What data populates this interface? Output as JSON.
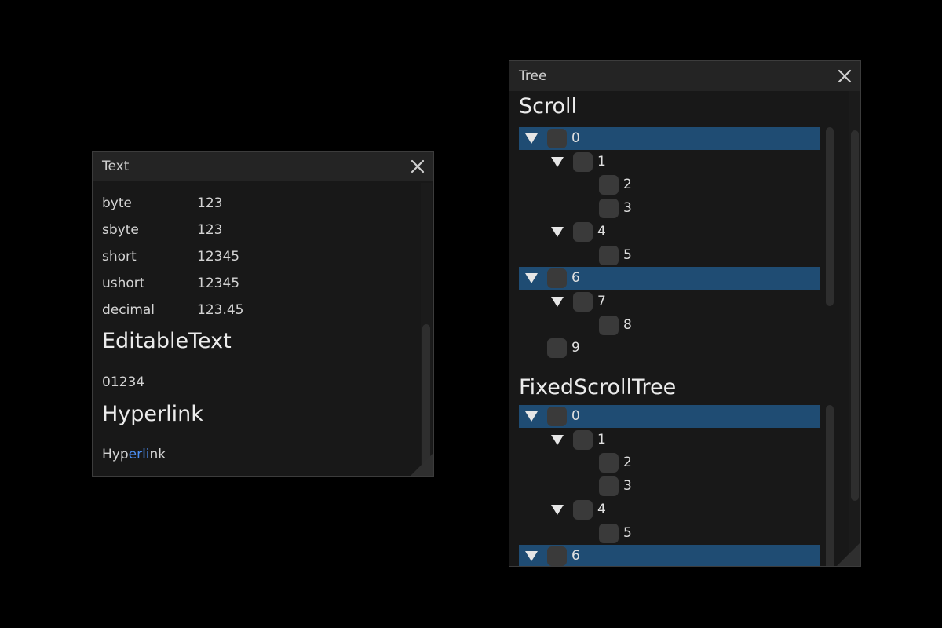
{
  "text_window": {
    "title": "Text",
    "rows": [
      {
        "key": "byte",
        "value": "123"
      },
      {
        "key": "sbyte",
        "value": "123"
      },
      {
        "key": "short",
        "value": "12345"
      },
      {
        "key": "ushort",
        "value": "12345"
      },
      {
        "key": "decimal",
        "value": "123.45"
      }
    ],
    "editable_heading": "EditableText",
    "editable_value": "01234",
    "hyperlink_heading": "Hyperlink",
    "hyperlink": {
      "prefix": "Hyp",
      "highlight": "erli",
      "suffix": "nk"
    }
  },
  "tree_window": {
    "title": "Tree",
    "scroll_heading": "Scroll",
    "fixed_heading": "FixedScrollTree",
    "scroll_nodes": [
      {
        "label": "0",
        "depth": 0,
        "expandable": true,
        "selected": true
      },
      {
        "label": "1",
        "depth": 1,
        "expandable": true,
        "selected": false
      },
      {
        "label": "2",
        "depth": 2,
        "expandable": false,
        "selected": false
      },
      {
        "label": "3",
        "depth": 2,
        "expandable": false,
        "selected": false
      },
      {
        "label": "4",
        "depth": 1,
        "expandable": true,
        "selected": false
      },
      {
        "label": "5",
        "depth": 2,
        "expandable": false,
        "selected": false
      },
      {
        "label": "6",
        "depth": 0,
        "expandable": true,
        "selected": true
      },
      {
        "label": "7",
        "depth": 1,
        "expandable": true,
        "selected": false
      },
      {
        "label": "8",
        "depth": 2,
        "expandable": false,
        "selected": false
      },
      {
        "label": "9",
        "depth": 0,
        "expandable": false,
        "selected": false
      }
    ],
    "fixed_nodes": [
      {
        "label": "0",
        "depth": 0,
        "expandable": true,
        "selected": true
      },
      {
        "label": "1",
        "depth": 1,
        "expandable": true,
        "selected": false
      },
      {
        "label": "2",
        "depth": 2,
        "expandable": false,
        "selected": false
      },
      {
        "label": "3",
        "depth": 2,
        "expandable": false,
        "selected": false
      },
      {
        "label": "4",
        "depth": 1,
        "expandable": true,
        "selected": false
      },
      {
        "label": "5",
        "depth": 2,
        "expandable": false,
        "selected": false
      },
      {
        "label": "6",
        "depth": 0,
        "expandable": true,
        "selected": true
      }
    ]
  },
  "colors": {
    "background": "#000000",
    "window": "#181818",
    "titlebar": "#242424",
    "selection": "#1f4c73",
    "link": "#4b8df0"
  },
  "icons": {
    "close": "close-icon",
    "expand": "expanded-arrow-icon",
    "checkbox": "checkbox"
  }
}
